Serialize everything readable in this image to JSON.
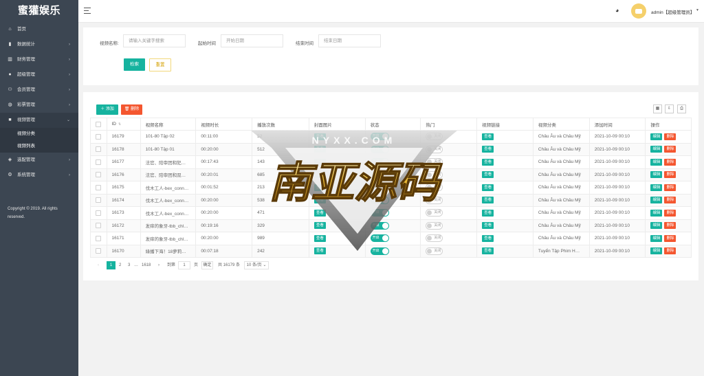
{
  "brand": "蜜獾娱乐",
  "sidebar": {
    "items": [
      {
        "label": "首页",
        "icon": "home-icon"
      },
      {
        "label": "数据统计",
        "icon": "bar-chart-icon"
      },
      {
        "label": "财务管理",
        "icon": "bank-icon"
      },
      {
        "label": "超级管理",
        "icon": "user-icon"
      },
      {
        "label": "会员管理",
        "icon": "users-icon"
      },
      {
        "label": "彩票管理",
        "icon": "gamepad-icon"
      },
      {
        "label": "视频管理",
        "icon": "video-icon"
      },
      {
        "label": "选配管理",
        "icon": "layers-icon"
      },
      {
        "label": "系统管理",
        "icon": "gear-icon"
      }
    ],
    "video_sub": [
      "视频分类",
      "视频列表"
    ],
    "copyright": "Copyright © 2019. All rights reserved."
  },
  "header": {
    "admin": "admin【超级管理员】"
  },
  "search": {
    "name_label": "视频名称:",
    "name_placeholder": "请输入关键字搜索",
    "start_label": "起始时间",
    "start_placeholder": "开始日期",
    "end_label": "结束时间",
    "end_placeholder": "结束日期",
    "search_btn": "检索",
    "reset_btn": "重置"
  },
  "toolbar": {
    "add": "添加",
    "delete": "删除"
  },
  "table": {
    "columns": [
      "ID",
      "视频名称",
      "视频时长",
      "播放次数",
      "封面图片",
      "状态",
      "热门",
      "视频链接",
      "视频分类",
      "添加时间",
      "操作"
    ],
    "view_label": "查看",
    "on_label": "开启",
    "off_label": "关闭",
    "edit_label": "编辑",
    "del_label": "删除",
    "rows": [
      {
        "id": "16179",
        "name": "101-80 Tập 02",
        "duration": "00:11:00",
        "plays": "52",
        "category": "Châu Âu và Châu Mỹ",
        "added": "2021-10-09 00:10"
      },
      {
        "id": "16178",
        "name": "101-80 Tập 01",
        "duration": "00:20:00",
        "plays": "512",
        "category": "Châu Âu và Châu Mỹ",
        "added": "2021-10-09 00:10"
      },
      {
        "id": "16177",
        "name": "法官、陪审团和犯…",
        "duration": "00:17:43",
        "plays": "143",
        "category": "Châu Âu và Châu Mỹ",
        "added": "2021-10-09 00:10"
      },
      {
        "id": "16176",
        "name": "法官、陪审团和双…",
        "duration": "00:20:01",
        "plays": "685",
        "category": "Châu Âu và Châu Mỹ",
        "added": "2021-10-09 00:10"
      },
      {
        "id": "16175",
        "name": "伐木工人-bex_conn…",
        "duration": "00:01:52",
        "plays": "213",
        "category": "Châu Âu và Châu Mỹ",
        "added": "2021-10-09 00:10"
      },
      {
        "id": "16174",
        "name": "伐木工人-bex_conn…",
        "duration": "00:20:00",
        "plays": "538",
        "category": "Châu Âu và Châu Mỹ",
        "added": "2021-10-09 00:10"
      },
      {
        "id": "16173",
        "name": "伐木工人-bex_conn…",
        "duration": "00:20:00",
        "plays": "471",
        "category": "Châu Âu và Châu Mỹ",
        "added": "2021-10-09 00:10"
      },
      {
        "id": "16172",
        "name": "发痒的象牙-tbb_chl…",
        "duration": "00:19:16",
        "plays": "329",
        "category": "Châu Âu và Châu Mỹ",
        "added": "2021-10-09 00:10"
      },
      {
        "id": "16171",
        "name": "发痒的象牙-tbb_chl…",
        "duration": "00:20:00",
        "plays": "989",
        "category": "Châu Âu và Châu Mỹ",
        "added": "2021-10-09 00:10"
      },
      {
        "id": "16170",
        "name": "綠播下海！18萝莉…",
        "duration": "00:07:18",
        "plays": "242",
        "category": "Tuyển Tập Phim H…",
        "added": "2021-10-09 00:10"
      }
    ]
  },
  "pager": {
    "pages": [
      "1",
      "2",
      "3"
    ],
    "ellipsis": "…",
    "last": "1618",
    "goto": "到第",
    "page_value": "1",
    "page_unit": "页",
    "confirm": "确定",
    "total": "共 16179 条",
    "per_page": "10 条/页"
  },
  "watermark_text": "南亚源码",
  "colors": {
    "accent": "#16b39f",
    "danger": "#f4562f",
    "sidebar": "#3c4652"
  }
}
